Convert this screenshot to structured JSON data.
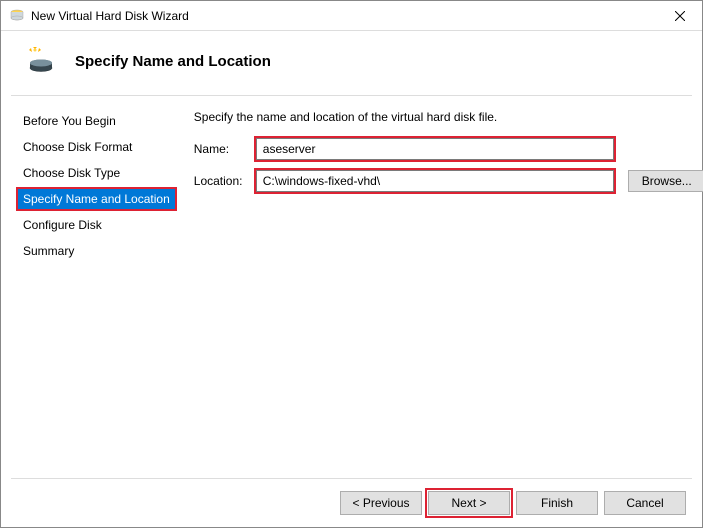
{
  "titlebar": {
    "title": "New Virtual Hard Disk Wizard"
  },
  "header": {
    "title": "Specify Name and Location"
  },
  "sidebar": {
    "items": [
      {
        "label": "Before You Begin"
      },
      {
        "label": "Choose Disk Format"
      },
      {
        "label": "Choose Disk Type"
      },
      {
        "label": "Specify Name and Location"
      },
      {
        "label": "Configure Disk"
      },
      {
        "label": "Summary"
      }
    ],
    "activeIndex": 3
  },
  "main": {
    "instruction": "Specify the name and location of the virtual hard disk file.",
    "name_label": "Name:",
    "name_value": "aseserver",
    "location_label": "Location:",
    "location_value": "C:\\windows-fixed-vhd\\",
    "browse_label": "Browse..."
  },
  "footer": {
    "previous": "< Previous",
    "next": "Next >",
    "finish": "Finish",
    "cancel": "Cancel"
  }
}
